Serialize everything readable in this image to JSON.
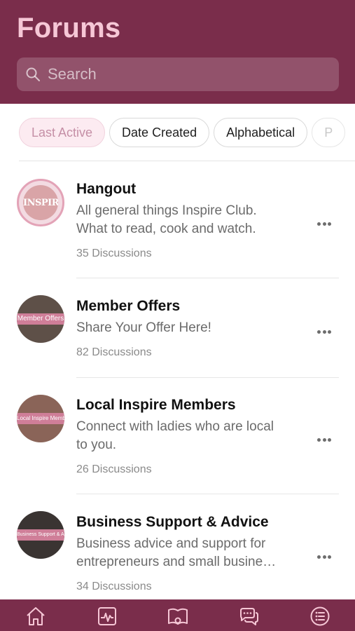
{
  "header": {
    "title": "Forums",
    "search_placeholder": "Search",
    "background": "#7a2d4b",
    "title_color": "#f6c7d6"
  },
  "filters": [
    {
      "label": "Last Active",
      "active": true
    },
    {
      "label": "Date Created",
      "active": false
    },
    {
      "label": "Alphabetical",
      "active": false
    },
    {
      "label": "P",
      "active": false
    }
  ],
  "forums": [
    {
      "title": "Hangout",
      "description_lines": [
        "All general things Inspire Club.",
        "What to read, cook and watch."
      ],
      "count": "35 Discussions",
      "avatar_text": "INSPIRE",
      "avatar_icon": "inspire-logo"
    },
    {
      "title": "Member Offers",
      "description_lines": [
        "Share Your Offer Here!"
      ],
      "count": "82 Discussions",
      "avatar_text": "Member Offers"
    },
    {
      "title": "Local Inspire Members",
      "description_lines": [
        "Connect with ladies who are local",
        "to you."
      ],
      "count": "26 Discussions",
      "avatar_text": "Local Inspire Members"
    },
    {
      "title": "Business Support & Advice",
      "description_lines": [
        "Business advice and support for",
        "entrepreneurs and small busine…"
      ],
      "count": "34 Discussions",
      "avatar_text": "Business Support & Advice"
    }
  ],
  "tabbar": {
    "icons": [
      "home-icon",
      "activity-icon",
      "forums-icon",
      "messages-icon",
      "menu-icon"
    ],
    "background": "#7a2d4b",
    "icon_color": "#f6c7d6"
  }
}
